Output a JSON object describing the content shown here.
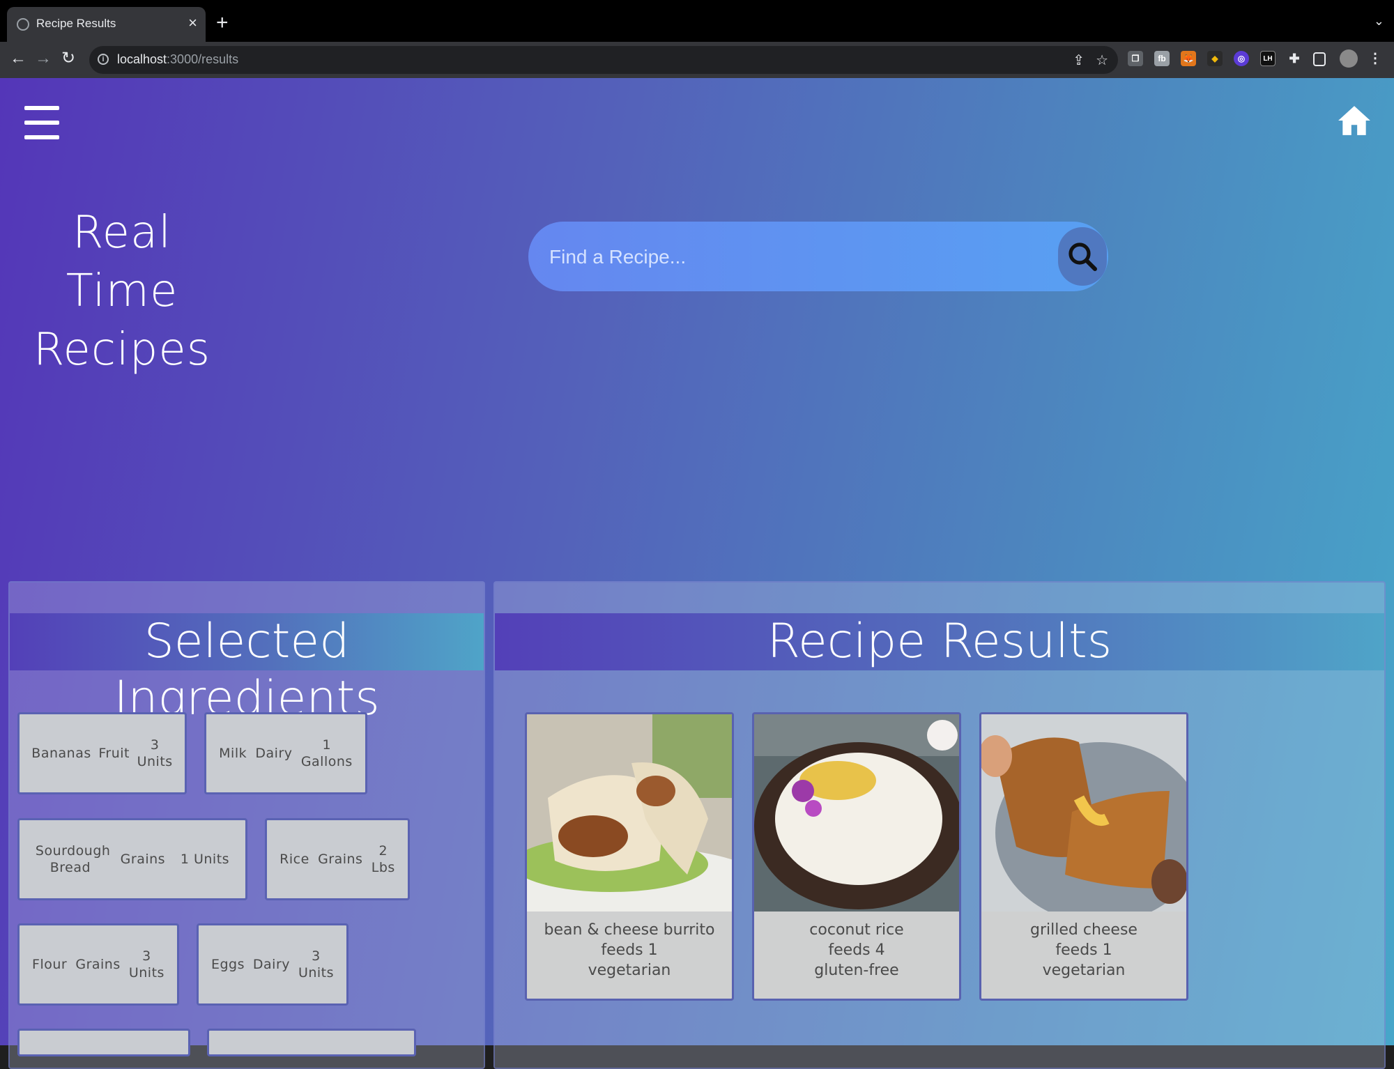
{
  "browser": {
    "tab_title": "Recipe Results",
    "url_host": "localhost",
    "url_path": ":3000/results",
    "extensions": [
      "copy-icon",
      "fb-extension-icon",
      "fox-extension-icon",
      "binance-extension-icon",
      "circle-extension-icon",
      "lh-extension-icon",
      "puzzle-icon",
      "sidebar-icon",
      "profile-avatar"
    ]
  },
  "header": {
    "brand_line1": "Real Time",
    "brand_line2": "Recipes",
    "search_placeholder": "Find a Recipe..."
  },
  "ingredients": {
    "title": "Selected Ingredients",
    "items": [
      {
        "name": "Bananas",
        "category": "Fruit",
        "qty": "3",
        "unit": "Units"
      },
      {
        "name": "Milk",
        "category": "Dairy",
        "qty": "1",
        "unit": "Gallons"
      },
      {
        "name": "Sourdough Bread",
        "category": "Grains",
        "qty": "1 Units",
        "unit": ""
      },
      {
        "name": "Rice",
        "category": "Grains",
        "qty": "2",
        "unit": "Lbs"
      },
      {
        "name": "Flour",
        "category": "Grains",
        "qty": "3",
        "unit": "Units"
      },
      {
        "name": "Eggs",
        "category": "Dairy",
        "qty": "3",
        "unit": "Units"
      }
    ]
  },
  "results": {
    "title": "Recipe Results",
    "recipes": [
      {
        "name": "bean & cheese burrito",
        "feeds": "feeds 1",
        "diet": "vegetarian"
      },
      {
        "name": "coconut rice",
        "feeds": "feeds 4",
        "diet": "gluten-free"
      },
      {
        "name": "grilled cheese",
        "feeds": "feeds 1",
        "diet": "vegetarian"
      }
    ]
  }
}
